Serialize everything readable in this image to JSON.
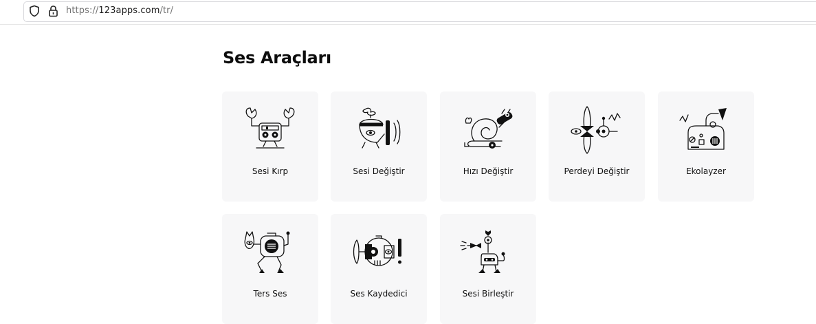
{
  "browser": {
    "url_scheme": "https://",
    "url_host": "123apps.com",
    "url_path": "/tr/"
  },
  "section": {
    "title": "Ses Araçları"
  },
  "tools": [
    {
      "label": "Sesi Kırp",
      "icon": "crab-robot-icon"
    },
    {
      "label": "Sesi Değiştir",
      "icon": "propeller-robot-icon"
    },
    {
      "label": "Hızı Değiştir",
      "icon": "snail-robot-icon"
    },
    {
      "label": "Perdeyi Değiştir",
      "icon": "dragonfly-robot-icon"
    },
    {
      "label": "Ekolayzer",
      "icon": "gramophone-robot-icon"
    },
    {
      "label": "Ters Ses",
      "icon": "walking-robot-icon"
    },
    {
      "label": "Ses Kaydedici",
      "icon": "fish-robot-icon"
    },
    {
      "label": "Sesi Birleştir",
      "icon": "camel-robot-icon"
    }
  ]
}
